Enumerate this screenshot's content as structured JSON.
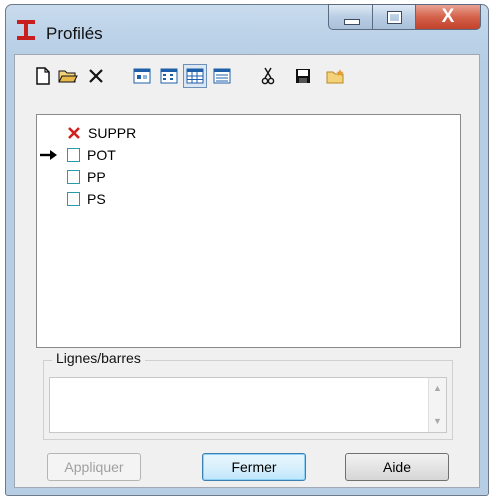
{
  "window": {
    "title": "Profilés",
    "close_glyph": "X"
  },
  "toolbar": {
    "buttons": [
      {
        "name": "new-icon"
      },
      {
        "name": "open-folder-icon"
      },
      {
        "name": "delete-icon"
      },
      {
        "name": "view-small-icons-icon"
      },
      {
        "name": "view-list-icon"
      },
      {
        "name": "view-grid-icon",
        "pressed": true
      },
      {
        "name": "view-details-icon"
      },
      {
        "name": "cut-icon"
      },
      {
        "name": "save-icon"
      },
      {
        "name": "new-folder-icon"
      }
    ]
  },
  "tree": {
    "items": [
      {
        "label": "SUPPR",
        "icon": "red-x-icon"
      },
      {
        "label": "POT",
        "icon": "checkbox-icon",
        "current": true
      },
      {
        "label": "PP",
        "icon": "checkbox-icon"
      },
      {
        "label": "PS",
        "icon": "checkbox-icon"
      }
    ]
  },
  "lines_group": {
    "title": "Lignes/barres",
    "scroll_up": "▲",
    "scroll_down": "▼"
  },
  "buttons": {
    "apply": "Appliquer",
    "close": "Fermer",
    "help": "Aide"
  },
  "colors": {
    "accent": "#3c7fb1",
    "close_red": "#c2412c",
    "delete_red": "#d32020",
    "checkbox_teal": "#2b9aa8"
  }
}
